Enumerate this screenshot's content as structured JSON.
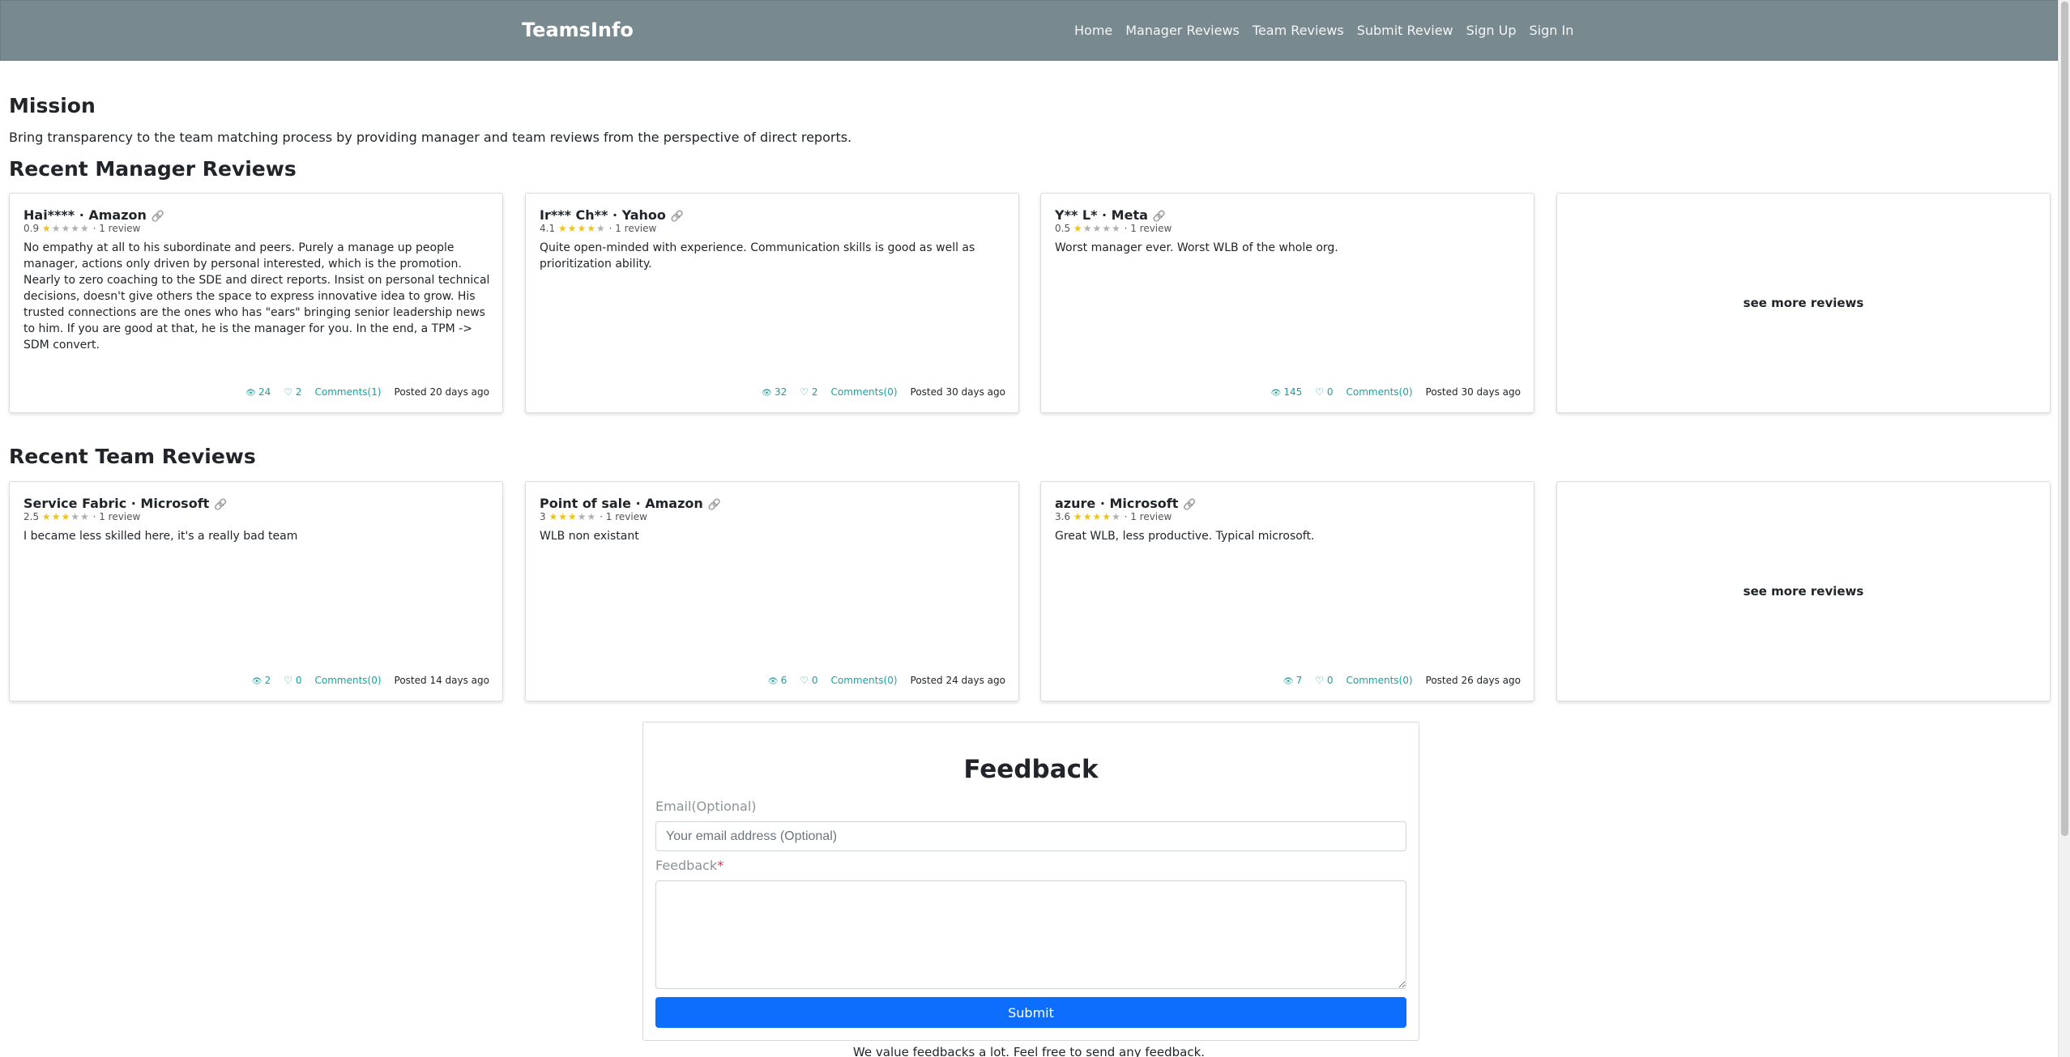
{
  "nav": {
    "brand": "TeamsInfo",
    "links": [
      "Home",
      "Manager Reviews",
      "Team Reviews",
      "Submit Review",
      "Sign Up",
      "Sign In"
    ]
  },
  "mission": {
    "title": "Mission",
    "text": "Bring transparency to the team matching process by providing manager and team reviews from the perspective of direct reports."
  },
  "manager_reviews": {
    "title": "Recent Manager Reviews",
    "see_more": "see more reviews",
    "cards": [
      {
        "name": "Hai**** · Amazon",
        "rating": "0.9",
        "stars": 1,
        "review_count": "· 1 review",
        "text": "No empathy at all to his subordinate and peers. Purely a manage up people manager, actions only driven by personal interested, which is the promotion. Nearly to zero coaching to the SDE and direct reports. Insist on personal technical decisions, doesn't give others the space to express innovative idea to grow. His trusted connections are the ones who has \"ears\" bringing senior leadership news to him. If you are good at that, he is the manager for you. In the end, a TPM -> SDM convert.",
        "views": "24",
        "likes": "2",
        "comments": "Comments(1)",
        "posted": "Posted 20 days ago"
      },
      {
        "name": "Ir*** Ch** · Yahoo",
        "rating": "4.1",
        "stars": 4,
        "review_count": "· 1 review",
        "text": "Quite open-minded with experience. Communication skills is good as well as prioritization ability.",
        "views": "32",
        "likes": "2",
        "comments": "Comments(0)",
        "posted": "Posted 30 days ago"
      },
      {
        "name": "Y** L* · Meta",
        "rating": "0.5",
        "stars": 1,
        "review_count": "· 1 review",
        "text": "Worst manager ever. Worst WLB of the whole org.",
        "views": "145",
        "likes": "0",
        "comments": "Comments(0)",
        "posted": "Posted 30 days ago"
      }
    ]
  },
  "team_reviews": {
    "title": "Recent Team Reviews",
    "see_more": "see more reviews",
    "cards": [
      {
        "name": "Service Fabric  · Microsoft",
        "rating": "2.5",
        "stars": 3,
        "review_count": "· 1 review",
        "text": "I became less skilled here, it's a really bad team",
        "views": "2",
        "likes": "0",
        "comments": "Comments(0)",
        "posted": "Posted 14 days ago"
      },
      {
        "name": "Point of sale · Amazon",
        "rating": "3",
        "stars": 3,
        "review_count": "· 1 review",
        "text": "WLB non existant",
        "views": "6",
        "likes": "0",
        "comments": "Comments(0)",
        "posted": "Posted 24 days ago"
      },
      {
        "name": "azure · Microsoft",
        "rating": "3.6",
        "stars": 4,
        "review_count": "· 1 review",
        "text": "Great WLB, less productive. Typical microsoft.",
        "views": "7",
        "likes": "0",
        "comments": "Comments(0)",
        "posted": "Posted 26 days ago"
      }
    ]
  },
  "feedback": {
    "title": "Feedback",
    "email_label": "Email(Optional)",
    "email_placeholder": "Your email address (Optional)",
    "feedback_label": "Feedback",
    "required_mark": "*",
    "submit_label": "Submit",
    "note": "We value feedbacks a lot. Feel free to send any feedback."
  },
  "icons": {
    "views": "eye-icon",
    "likes": "heart-icon",
    "link": "link-icon"
  },
  "colors": {
    "navbar": "#78898f",
    "accent": "#17a2a0",
    "submit": "#0d6efd",
    "star": "#f1c40f"
  }
}
